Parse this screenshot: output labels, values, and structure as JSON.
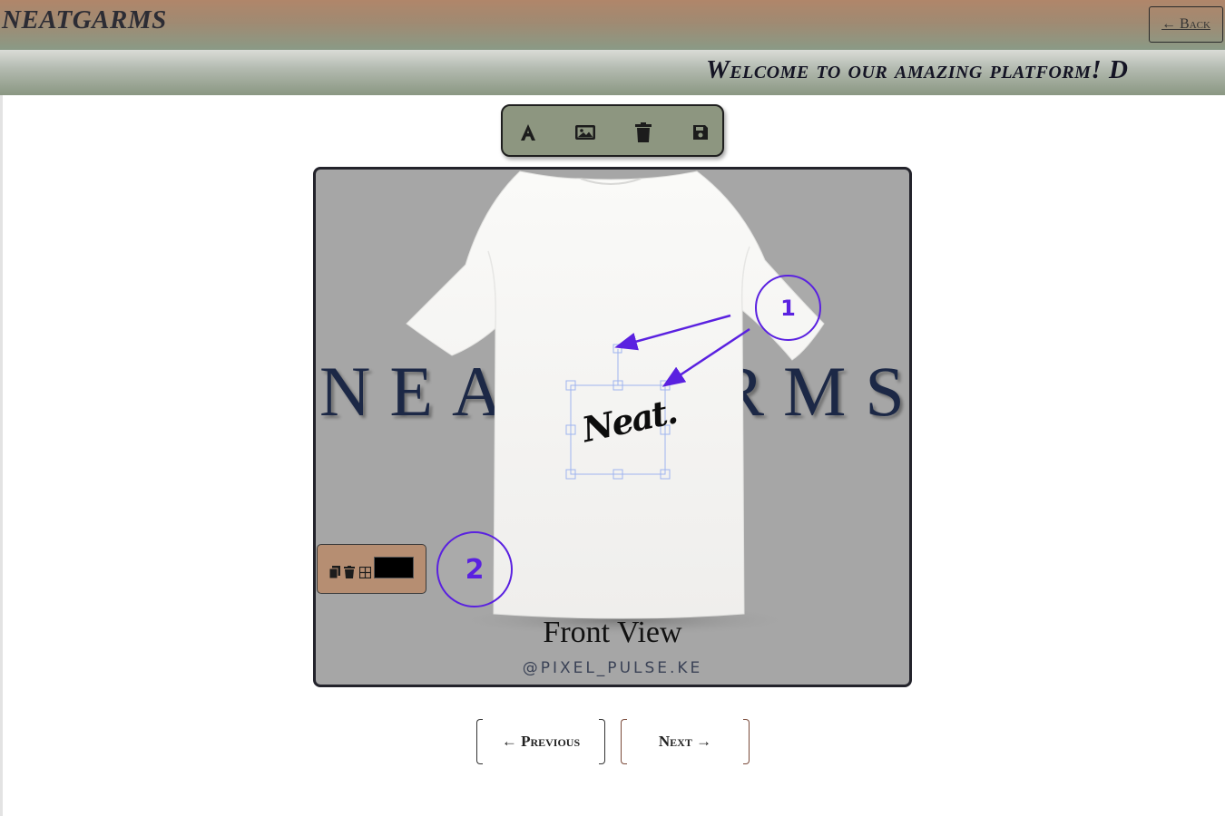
{
  "header": {
    "brand": "NEATGARMS",
    "back_label": "← Back"
  },
  "marquee": {
    "text": "Welcome to our amazing platform! D"
  },
  "toolbar": {
    "tools": [
      {
        "icon": "text-icon",
        "name": "add-text"
      },
      {
        "icon": "image-icon",
        "name": "add-image"
      },
      {
        "icon": "trash-icon",
        "name": "delete"
      },
      {
        "icon": "save-icon",
        "name": "save"
      }
    ]
  },
  "canvas": {
    "background_brand": "NEATGARMS",
    "logo_text": "Neat.",
    "caption": "Front View",
    "handle": "@PIXEL_PULSE.KE"
  },
  "annotations": {
    "callout_1": "1",
    "callout_2": "2"
  },
  "object_toolbar": {
    "icons": [
      "copy-icon",
      "trash-icon",
      "grid-icon"
    ],
    "swatch_color": "#000000"
  },
  "pager": {
    "previous_label": "← Previous",
    "next_label": "Next →"
  },
  "colors": {
    "accent_annotation": "#5a21e0",
    "toolbar_bg": "#8d9680",
    "object_bar_bg": "#b68e72",
    "canvas_bg": "#a6a6a6"
  }
}
